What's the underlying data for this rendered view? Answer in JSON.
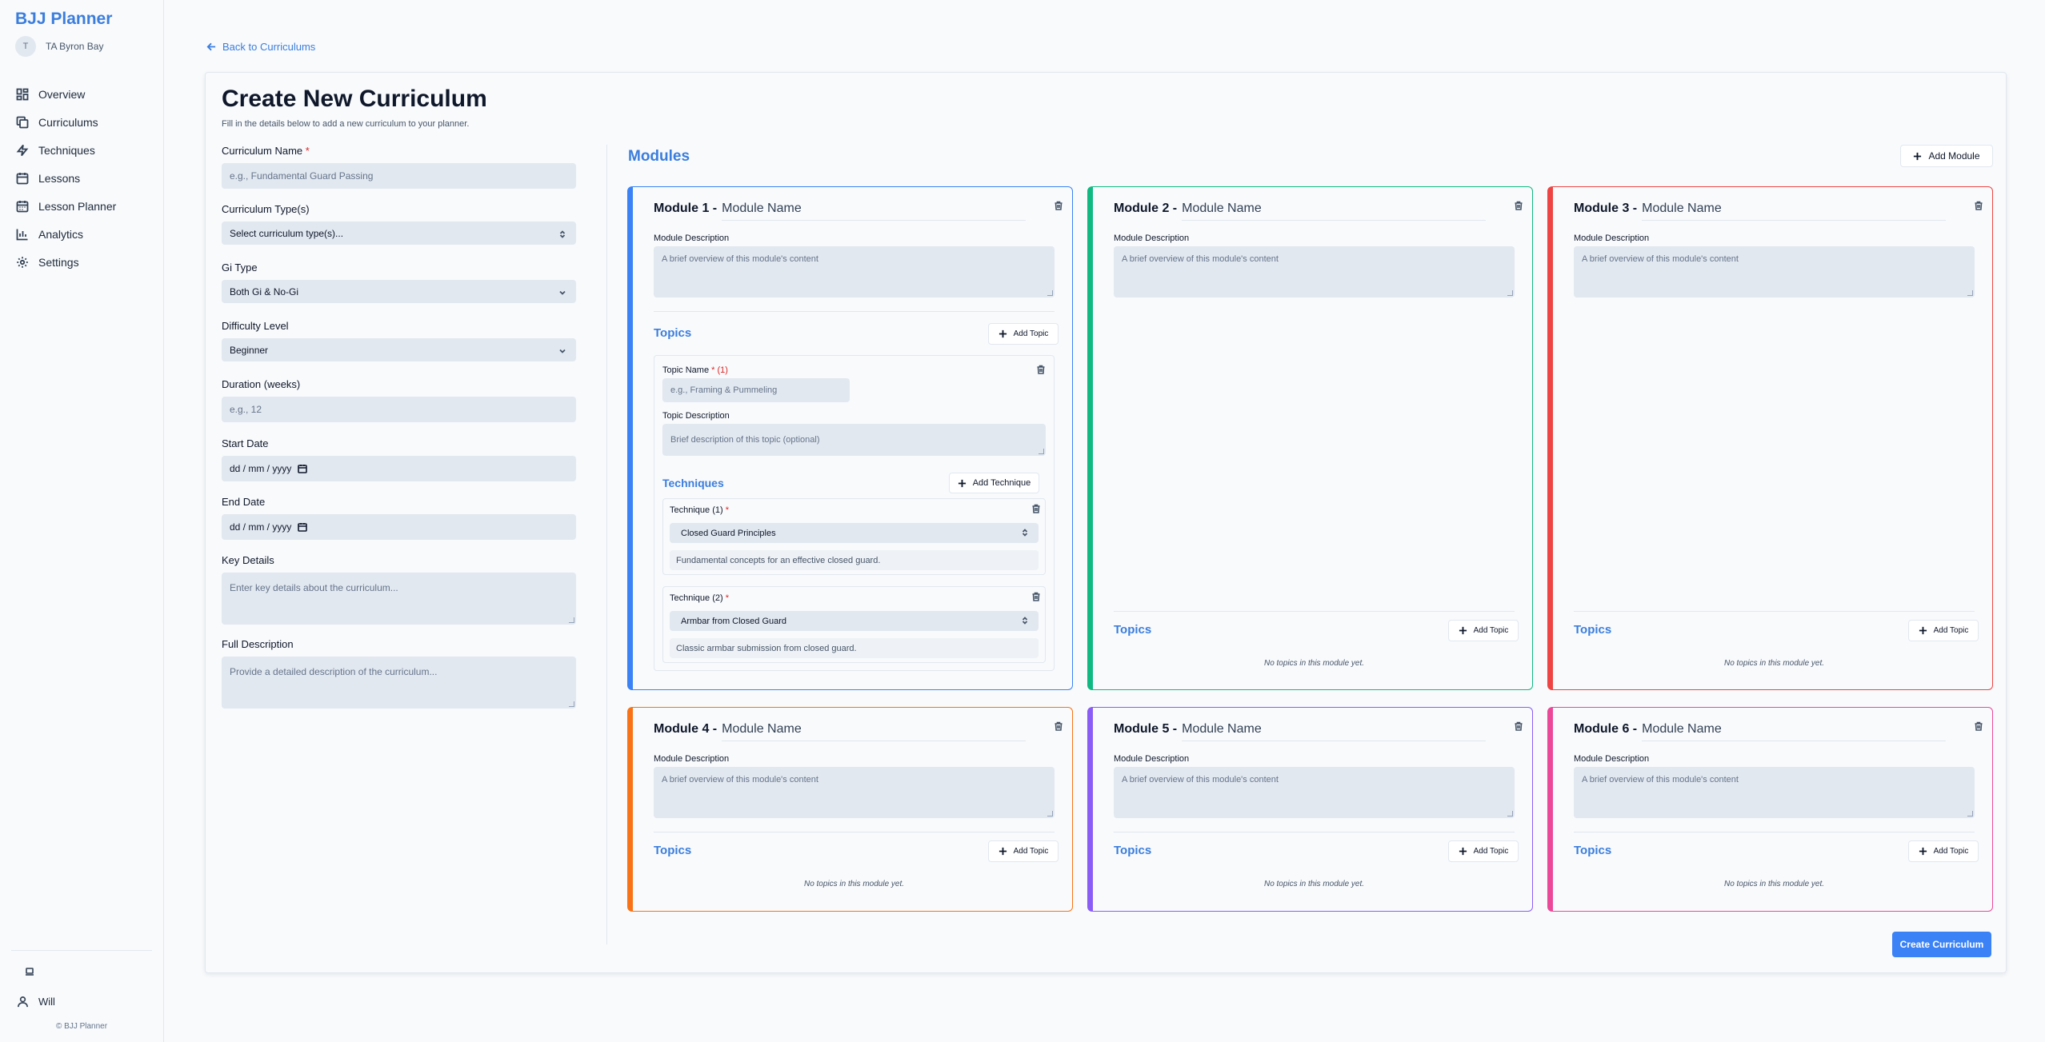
{
  "sidebar": {
    "brand": "BJJ Planner",
    "org_initial": "T",
    "org_name": "TA Byron Bay",
    "items": [
      {
        "label": "Overview",
        "icon": "grid-icon"
      },
      {
        "label": "Curriculums",
        "icon": "copy-icon"
      },
      {
        "label": "Techniques",
        "icon": "zap-icon"
      },
      {
        "label": "Lessons",
        "icon": "calendar-icon"
      },
      {
        "label": "Lesson Planner",
        "icon": "calendar-grid-icon"
      },
      {
        "label": "Analytics",
        "icon": "bar-chart-icon"
      },
      {
        "label": "Settings",
        "icon": "gear-icon"
      }
    ],
    "user": "Will",
    "copyright": "© BJJ Planner"
  },
  "header": {
    "back_label": "Back to Curriculums",
    "title": "Create New Curriculum",
    "subtitle": "Fill in the details below to add a new curriculum to your planner."
  },
  "form": {
    "name": {
      "label": "Curriculum Name",
      "required": "*",
      "placeholder": "e.g., Fundamental Guard Passing"
    },
    "type": {
      "label": "Curriculum Type(s)",
      "value": "Select curriculum type(s)..."
    },
    "gi": {
      "label": "Gi Type",
      "value": "Both Gi & No-Gi"
    },
    "difficulty": {
      "label": "Difficulty Level",
      "value": "Beginner"
    },
    "duration": {
      "label": "Duration (weeks)",
      "placeholder": "e.g., 12"
    },
    "start": {
      "label": "Start Date",
      "value": "dd / mm / yyyy"
    },
    "end": {
      "label": "End Date",
      "value": "dd / mm / yyyy"
    },
    "key_details": {
      "label": "Key Details",
      "placeholder": "Enter key details about the curriculum..."
    },
    "full_desc": {
      "label": "Full Description",
      "placeholder": "Provide a detailed description of the curriculum..."
    }
  },
  "modules_section": {
    "title": "Modules",
    "add_module": "Add Module",
    "create_button": "Create Curriculum",
    "desc_label": "Module Description",
    "desc_placeholder": "A brief overview of this module's content",
    "name_placeholder": "Module Name",
    "topics_label": "Topics",
    "add_topic": "Add Topic",
    "no_topics": "No topics in this module yet."
  },
  "modules": [
    {
      "label": "Module 1 -",
      "color": "#3b82f6"
    },
    {
      "label": "Module 2 -",
      "color": "#10b981"
    },
    {
      "label": "Module 3 -",
      "color": "#ef4444"
    },
    {
      "label": "Module 4 -",
      "color": "#f97316"
    },
    {
      "label": "Module 5 -",
      "color": "#8b5cf6"
    },
    {
      "label": "Module 6 -",
      "color": "#ec4899"
    }
  ],
  "topic": {
    "name_label": "Topic Name",
    "name_req": "* (1)",
    "name_placeholder": "e.g., Framing & Pummeling",
    "desc_label": "Topic Description",
    "desc_placeholder": "Brief description of this topic (optional)",
    "techniques_label": "Techniques",
    "add_technique": "Add Technique",
    "techniques": [
      {
        "label": "Technique (1)",
        "req": "*",
        "value": "Closed Guard Principles",
        "desc": "Fundamental concepts for an effective closed guard."
      },
      {
        "label": "Technique (2)",
        "req": "*",
        "value": "Armbar from Closed Guard",
        "desc": "Classic armbar submission from closed guard."
      }
    ]
  }
}
